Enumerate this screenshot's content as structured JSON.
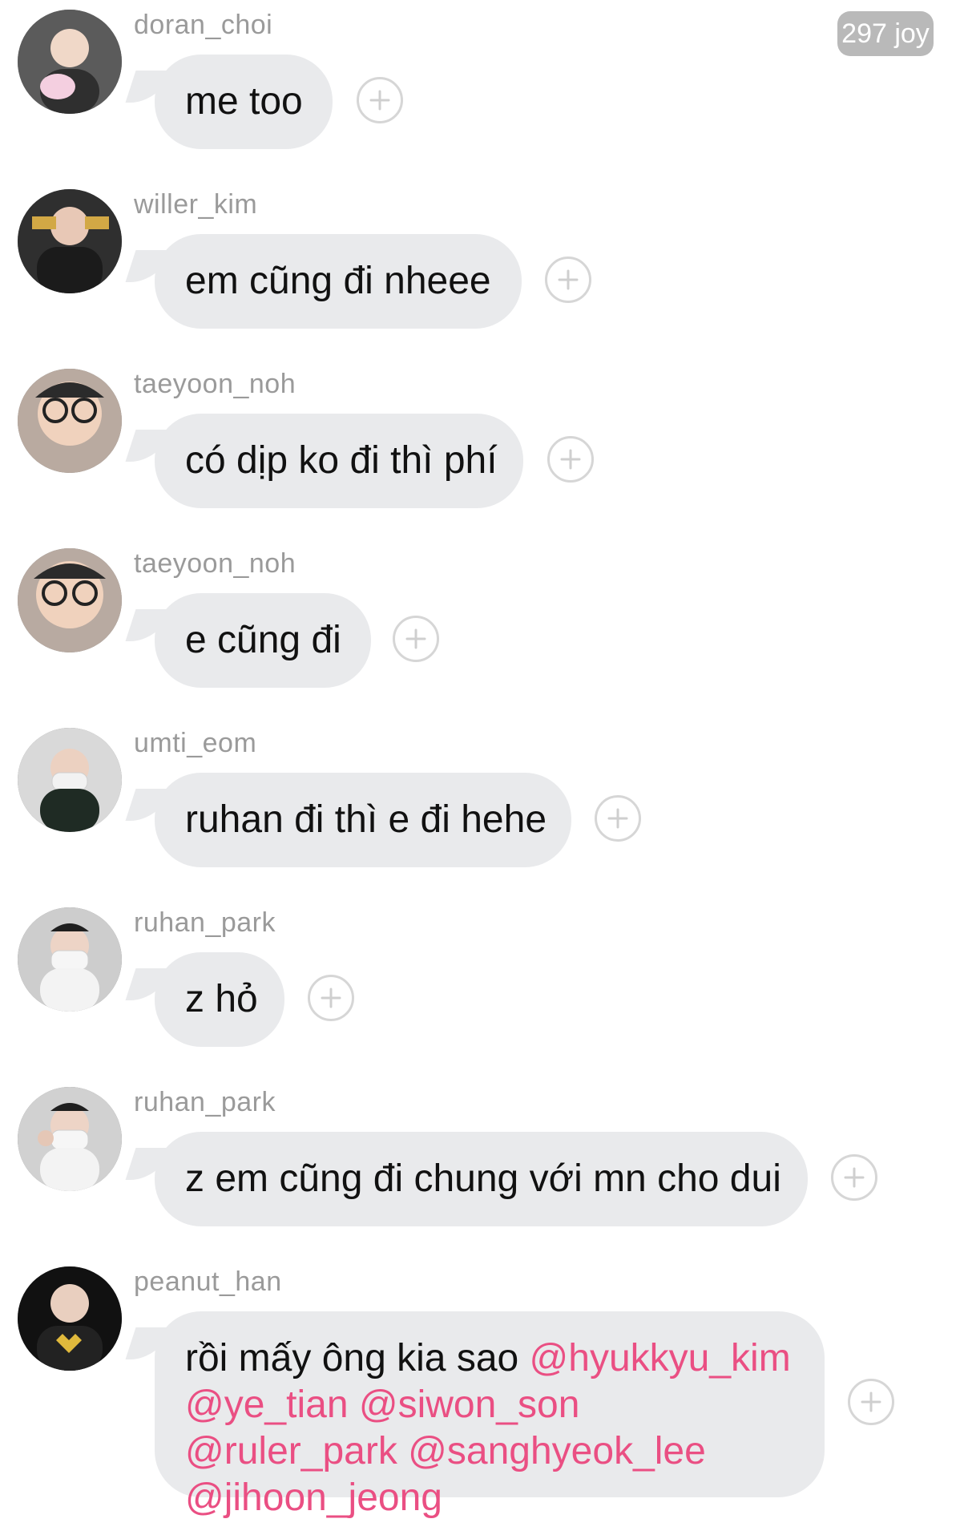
{
  "joy_badge": "297 joy",
  "messages": [
    {
      "username": "doran_choi",
      "text": "me too",
      "avatar_icon": "profile-photo"
    },
    {
      "username": "willer_kim",
      "text": "em cũng đi nheee",
      "avatar_icon": "profile-photo"
    },
    {
      "username": "taeyoon_noh",
      "text": "có dịp ko đi thì phí",
      "avatar_icon": "profile-photo"
    },
    {
      "username": "taeyoon_noh",
      "text": "e cũng đi",
      "avatar_icon": "profile-photo"
    },
    {
      "username": "umti_eom",
      "text": "ruhan đi thì e đi hehe",
      "avatar_icon": "profile-photo"
    },
    {
      "username": "ruhan_park",
      "text": "z hỏ",
      "avatar_icon": "profile-photo"
    },
    {
      "username": "ruhan_park",
      "text": "z em cũng đi chung với mn cho dui",
      "avatar_icon": "profile-photo"
    },
    {
      "username": "peanut_han",
      "text_parts": [
        "rồi mấy ông kia sao ",
        "@hyukkyu_kim",
        "@ye_tian",
        "@siwon_son",
        "@ruler_park",
        "@sanghyeok_lee",
        "@jihoon_jeong"
      ],
      "avatar_icon": "profile-photo"
    }
  ],
  "colors": {
    "bubble": "#e9eaec",
    "username": "#9a9a9a",
    "mention": "#ea4f83",
    "react_border": "#d6d6d6",
    "badge": "#b9b9b9"
  },
  "icons": {
    "react": "plus-circle-icon"
  }
}
